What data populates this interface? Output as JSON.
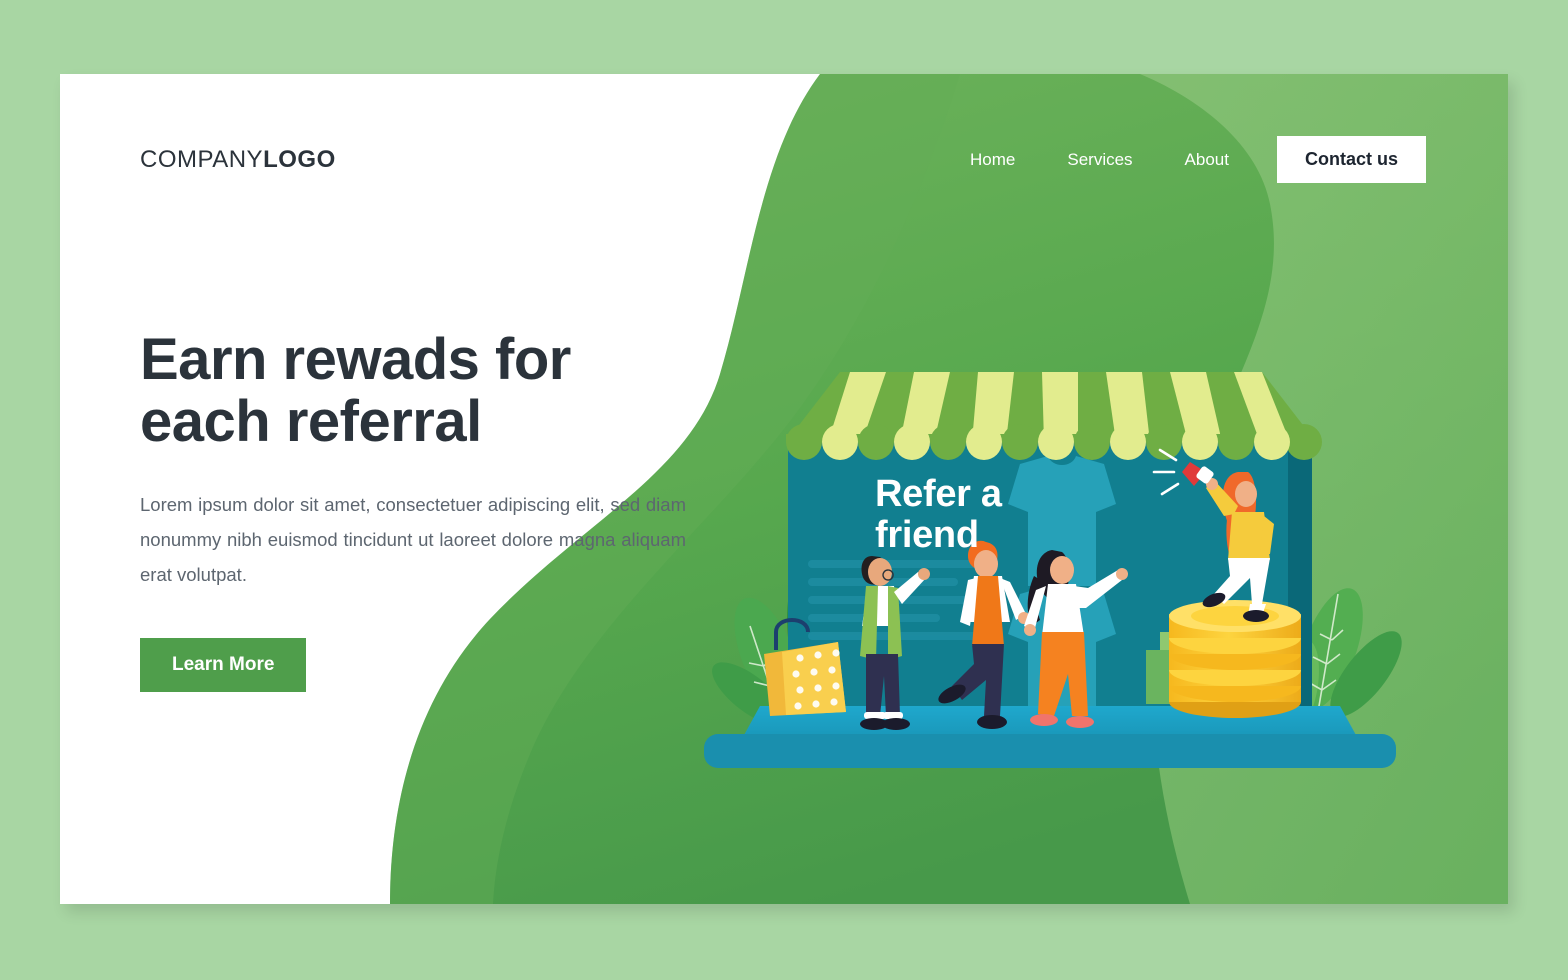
{
  "theme": {
    "page_background": "#a8d6a3",
    "card_background": "#ffffff",
    "green_dark": "#4a9e4a",
    "green_light": "#7bbc68",
    "green_mid": "#63ad57",
    "accent_button": "#4f9e4b",
    "heading_color": "#2b333b",
    "body_text_color": "#5d6670",
    "shop_wall": "#117b8c",
    "shop_wall_dark": "#0d6d7d",
    "shop_floor": "#1b9fc4",
    "awning_green": "#6fae44",
    "awning_light": "#e2ec8e",
    "coin_gold": "#f9c82e",
    "bag_yellow": "#f7c948",
    "megaphone_red": "#e03a3a"
  },
  "header": {
    "logo_thin": "COMPANY",
    "logo_bold": "LOGO",
    "nav": [
      {
        "label": "Home"
      },
      {
        "label": "Services"
      },
      {
        "label": "About"
      }
    ],
    "contact_button": "Contact us"
  },
  "hero": {
    "headline": "Earn rewads for each referral",
    "paragraph": "Lorem ipsum dolor sit amet, consectetuer adipiscing elit, sed diam nonummy nibh euismod tincidunt ut laoreet dolore magna aliquam erat volutpat.",
    "cta_label": "Learn More"
  },
  "illustration": {
    "shop_sign": "Refer a\nfriend",
    "awning_stripe_count": 13,
    "characters": [
      {
        "name": "person-thumbs-up",
        "top": "#8cc153",
        "bottom": "#2f3050"
      },
      {
        "name": "man-orange-vest",
        "top": "#f07818",
        "bottom": "#2f3050"
      },
      {
        "name": "woman-pointing",
        "top": "#ffffff",
        "bottom": "#f58220"
      },
      {
        "name": "woman-megaphone",
        "top": "#f5cb3c",
        "bottom": "#ffffff"
      }
    ],
    "props": [
      "shopping-bag",
      "gift-box",
      "coin-stack",
      "tshirt-graphic",
      "plant-leaves",
      "megaphone"
    ]
  }
}
